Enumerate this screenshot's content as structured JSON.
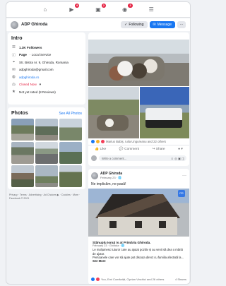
{
  "nav": {
    "icons": [
      "home-icon",
      "watch-icon",
      "marketplace-icon",
      "groups-icon",
      "menu-icon"
    ],
    "badges": {
      "watch": "9",
      "marketplace": "2",
      "groups": "3"
    }
  },
  "page": {
    "name": "ADP Ghiroda",
    "following_label": "Following",
    "message_label": "Message",
    "more_label": "···"
  },
  "intro": {
    "title": "Intro",
    "followers": "1.3K Followers",
    "category_prefix": "Page",
    "category": " · Local Service",
    "address": "Str. Bistra nr. 9, Ghiroda, Romania",
    "email": "adpghiroda@gmail.com",
    "website": "adpghiroda.ro",
    "hours_status": "Closed Now",
    "rating": "Not yet rated (8 Reviews)"
  },
  "photos": {
    "title": "Photos",
    "see_all": "See All Photos"
  },
  "footer": "Privacy · Terms · Advertising · Ad Choices ▶ · Cookies · More · Facebook © 2021",
  "post1": {
    "reactions_text": "Marius Babiș, Iulia Ungureanu and 22 others",
    "like_label": "Like",
    "comment_label": "Comment",
    "share_label": "Share",
    "comment_placeholder": "Write a comment..."
  },
  "post2": {
    "author": "ADP Ghiroda",
    "date": "February 23 · 🌐",
    "text": "Ne implicăm, ne pasă!",
    "shared_title": "Stănuplu Ionuț is at Primăria Ghiroda.",
    "shared_date": "February 23 · Ghiroda · 🌐",
    "shared_line1": "Le mulțumesc tuturor care au ajutat pozitiv și au venit să dea o mână de ajutor.",
    "shared_line2": "Persoanele care vor să ajute pot discuta direct cu familia afectată la...",
    "see_more": "See More",
    "sticker": "PR",
    "reactions_text": "You, Emi Comăniță, Ciprian Vinchici and 26 others",
    "shares_text": "4 Shares"
  }
}
